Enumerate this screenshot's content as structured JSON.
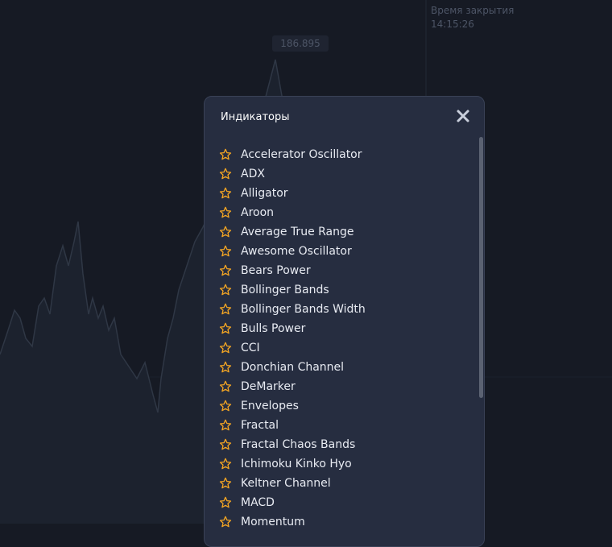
{
  "close_time": {
    "label": "Время закрытия",
    "value": "14:15:26"
  },
  "price_tag": "186.895",
  "modal": {
    "title": "Индикаторы",
    "close_icon": "close-icon",
    "item_icon": "star-outline-icon",
    "items": [
      "Accelerator Oscillator",
      "ADX",
      "Alligator",
      "Aroon",
      "Average True Range",
      "Awesome Oscillator",
      "Bears Power",
      "Bollinger Bands",
      "Bollinger Bands Width",
      "Bulls Power",
      "CCI",
      "Donchian Channel",
      "DeMarker",
      "Envelopes",
      "Fractal",
      "Fractal Chaos Bands",
      "Ichimoku Kinko Hyo",
      "Keltner Channel",
      "MACD",
      "Momentum"
    ]
  },
  "colors": {
    "background": "#161a24",
    "modal_bg": "#262d40",
    "star": "#f5a623",
    "text": "#e8ebf2"
  }
}
